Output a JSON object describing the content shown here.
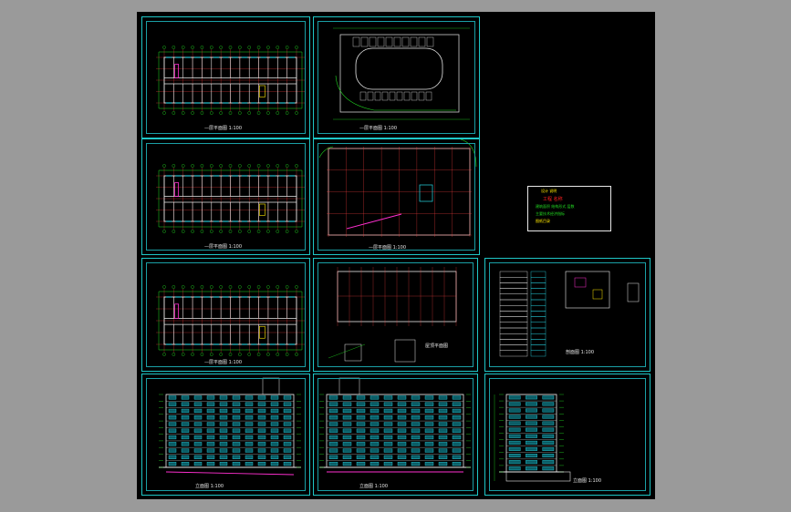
{
  "app": {
    "window_background": "#9a9a9a",
    "canvas_background": "#000000"
  },
  "colors": {
    "frame": "#1fc7c7",
    "axis_grid": "#ff4040",
    "wall": "#e8e8e8",
    "dim_line": "#22dd22",
    "window": "#28d7e6",
    "accent_magenta": "#ff2fd0",
    "accent_yellow": "#ffe800",
    "accent_red": "#ff2020"
  },
  "sheets": [
    {
      "id": "floor-plan-1",
      "caption": "—层平面图 1:100"
    },
    {
      "id": "site-plan",
      "caption": "—层平面图 1:100"
    },
    {
      "id": "floor-plan-2",
      "caption": "—层平面图 1:100"
    },
    {
      "id": "basement-plan",
      "caption": "—层平面图 1:100"
    },
    {
      "id": "floor-plan-3",
      "caption": "—层平面图 1:100"
    },
    {
      "id": "roof-plan",
      "caption": "屋顶平面图"
    },
    {
      "id": "section-detail",
      "caption": "剖面图 1:100"
    },
    {
      "id": "elevation-front",
      "caption": "立面图 1:100"
    },
    {
      "id": "elevation-back",
      "caption": "立面图 1:100"
    },
    {
      "id": "elevation-side",
      "caption": "立面图 1:100"
    }
  ],
  "title_block": {
    "line1": "设计  说明",
    "line2": "工程 名称",
    "line3": "建筑面积  结构形式  层数",
    "line4": "主要技术经济指标",
    "line5": "图纸目录"
  }
}
